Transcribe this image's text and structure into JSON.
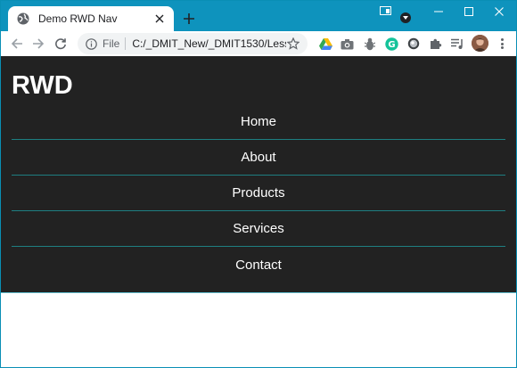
{
  "browser": {
    "tab": {
      "title": "Demo RWD Nav"
    },
    "omnibox": {
      "scheme": "File",
      "url": "C:/_DMIT_New/_DMIT1530/Lesson..."
    }
  },
  "site": {
    "brand": "RWD",
    "nav": [
      {
        "label": "Home"
      },
      {
        "label": "About"
      },
      {
        "label": "Products"
      },
      {
        "label": "Services"
      },
      {
        "label": "Contact"
      }
    ]
  },
  "colors": {
    "titlebar": "#0e93bd",
    "header_bg": "#222222",
    "nav_divider": "#1e7f82"
  }
}
